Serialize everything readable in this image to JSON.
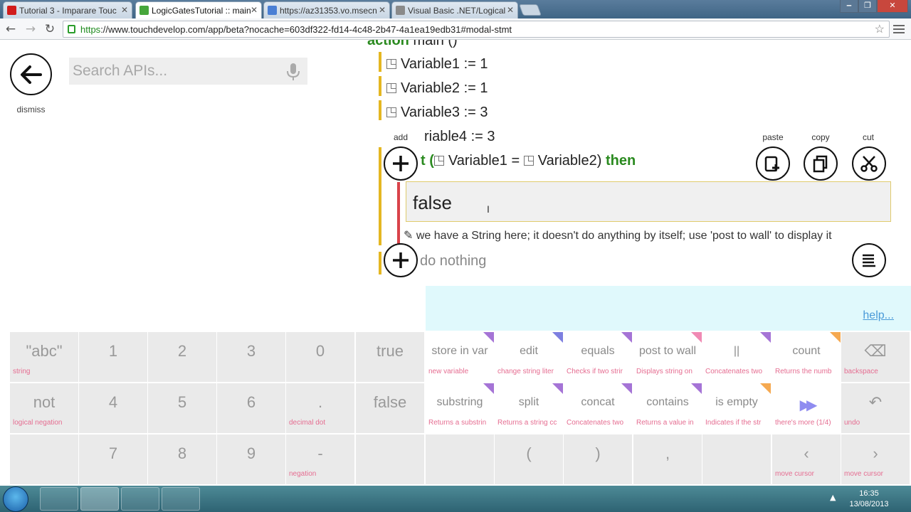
{
  "browser": {
    "tabs": [
      {
        "title": "Tutorial 3 - Imparare Touc",
        "favicon_color": "#d11c1c"
      },
      {
        "title": "LogicGatesTutorial :: main",
        "favicon_color": "#46a63b"
      },
      {
        "title": "https://az31353.vo.msecn",
        "favicon_color": "#4a7fd4"
      },
      {
        "title": "Visual Basic .NET/Logical",
        "favicon_color": "#8a8a8a"
      }
    ],
    "url_scheme": "https",
    "url_rest": "://www.touchdevelop.com/app/beta?nocache=603df322-fd14-4c48-2b47-4a1ea19edb31#modal-stmt"
  },
  "sidebar": {
    "dismiss_label": "dismiss",
    "search_placeholder": "Search APIs..."
  },
  "code": {
    "header_keyword": "action",
    "header_rest": " main ()",
    "lines": [
      {
        "text": "Variable1 := 1"
      },
      {
        "text": "Variable2 := 1"
      },
      {
        "text": "Variable3 := 3"
      },
      {
        "text": "riable4 := 3"
      }
    ],
    "if_prefix": "t (",
    "if_var1": "Variable1",
    "if_op": " = ",
    "if_var2": "Variable2)",
    "if_then": "then",
    "edit_value": "false",
    "comment_icon": "✎",
    "comment": "we have a String here; it doesn't do anything by itself; use 'post to wall' to display it",
    "do_nothing": "do nothing",
    "add_label": "add",
    "paste_label": "paste",
    "copy_label": "copy",
    "cut_label": "cut"
  },
  "help": {
    "link": "help..."
  },
  "keyboard": {
    "rows": [
      [
        {
          "main": "\"abc\"",
          "sub": "string"
        },
        {
          "main": "1",
          "sub": ""
        },
        {
          "main": "2",
          "sub": ""
        },
        {
          "main": "3",
          "sub": ""
        },
        {
          "main": "0",
          "sub": ""
        },
        {
          "main": "true",
          "sub": ""
        },
        {
          "main": "store in var",
          "sub": "new variable",
          "api": true,
          "corner": "#a574d6"
        },
        {
          "main": "edit",
          "sub": "change string liter",
          "api": true,
          "corner": "#7d7fe0"
        },
        {
          "main": "equals",
          "sub": "Checks if two strir",
          "api": true,
          "corner": "#a574d6"
        },
        {
          "main": "post to wall",
          "sub": "Displays string on",
          "api": true,
          "corner": "#f08ab4"
        },
        {
          "main": "||",
          "sub": "Concatenates two",
          "api": true,
          "corner": "#a574d6"
        },
        {
          "main": "count",
          "sub": "Returns the numb",
          "api": true,
          "corner": "#f5a951"
        },
        {
          "main": "⌫",
          "sub": "backspace"
        }
      ],
      [
        {
          "main": "not",
          "sub": "logical negation"
        },
        {
          "main": "4",
          "sub": ""
        },
        {
          "main": "5",
          "sub": ""
        },
        {
          "main": "6",
          "sub": ""
        },
        {
          "main": ".",
          "sub": "decimal dot"
        },
        {
          "main": "false",
          "sub": ""
        },
        {
          "main": "substring",
          "sub": "Returns a substrin",
          "api": true,
          "corner": "#a574d6"
        },
        {
          "main": "split",
          "sub": "Returns a string cc",
          "api": true,
          "corner": "#a574d6"
        },
        {
          "main": "concat",
          "sub": "Concatenates two",
          "api": true,
          "corner": "#a574d6"
        },
        {
          "main": "contains",
          "sub": "Returns a value in",
          "api": true,
          "corner": "#a574d6"
        },
        {
          "main": "is empty",
          "sub": "Indicates if the str",
          "api": true,
          "corner": "#f5a951"
        },
        {
          "main": "▶▶",
          "sub": "there's more (1/4)",
          "api": true
        },
        {
          "main": "↶",
          "sub": "undo"
        }
      ],
      [
        {
          "main": "",
          "sub": ""
        },
        {
          "main": "7",
          "sub": ""
        },
        {
          "main": "8",
          "sub": ""
        },
        {
          "main": "9",
          "sub": ""
        },
        {
          "main": "-",
          "sub": "negation"
        },
        {
          "main": "",
          "sub": ""
        },
        {
          "main": "",
          "sub": ""
        },
        {
          "main": "(",
          "sub": ""
        },
        {
          "main": ")",
          "sub": ""
        },
        {
          "main": ",",
          "sub": ""
        },
        {
          "main": "",
          "sub": ""
        },
        {
          "main": "‹",
          "sub": "move cursor"
        },
        {
          "main": "›",
          "sub": "move cursor"
        }
      ]
    ]
  },
  "taskbar": {
    "time": "16:35",
    "date": "13/08/2013"
  },
  "colors": {
    "keyword_green": "#2a8a1f",
    "block_yellow": "#e4b722",
    "block_red": "#d9434a",
    "hint_pink": "#e56d91",
    "help_bg": "#e0f9fc"
  }
}
